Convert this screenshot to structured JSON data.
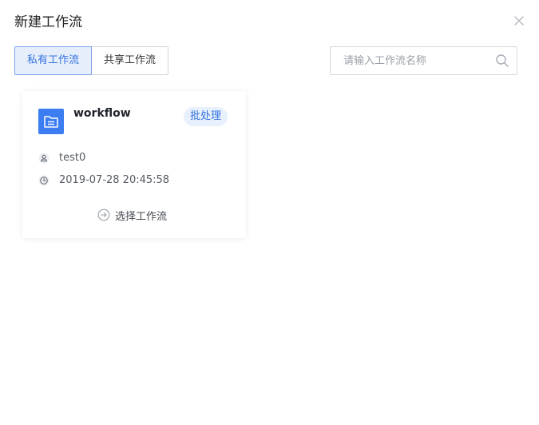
{
  "dialog": {
    "title": "新建工作流",
    "close_icon": "close-icon"
  },
  "tabs": [
    {
      "label": "私有工作流",
      "active": true
    },
    {
      "label": "共享工作流",
      "active": false
    }
  ],
  "search": {
    "value": "",
    "placeholder": "请输入工作流名称",
    "icon": "search-icon"
  },
  "workflows": [
    {
      "name": "workflow",
      "type_badge": "批处理",
      "owner": "test0",
      "created_at": "2019-07-28 20:45:58",
      "action_label": "选择工作流",
      "icon": "folder-icon"
    }
  ],
  "colors": {
    "accent": "#3572e0",
    "accent_bg": "#e6eefc",
    "folder": "#3c7df2"
  }
}
